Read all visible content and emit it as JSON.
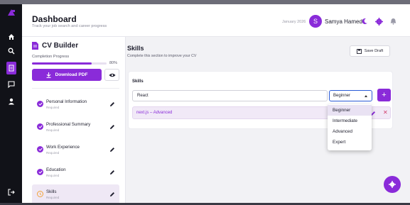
{
  "header": {
    "title": "Dashboard",
    "subtitle": "Track your job search and career progress",
    "date": "January 2026",
    "avatar_initial": "S",
    "user_name": "Samya Hamed"
  },
  "sidebar": {
    "title": "CV Builder",
    "completion_label": "Completion Progress",
    "completion_percent": "80%",
    "completion_fraction": 0.8,
    "download_label": "Download PDF",
    "steps": [
      {
        "label": "Personal Information",
        "status": "Required"
      },
      {
        "label": "Professional Summary",
        "status": "Required"
      },
      {
        "label": "Work Experience",
        "status": "Required"
      },
      {
        "label": "Education",
        "status": "Required"
      },
      {
        "label": "Skills",
        "status": "Required"
      }
    ]
  },
  "main": {
    "title": "Skills",
    "subtitle": "Complete this section to improve your CV",
    "save_label": "Save Draft",
    "card_label": "Skills",
    "skill_input_value": "React",
    "level_value": "Beginner",
    "skills": [
      {
        "name": "next.js",
        "separator": " – ",
        "level": "Advanced"
      }
    ]
  },
  "level_menu": {
    "options": [
      "Beginner",
      "Intermediate",
      "Advanced",
      "Expert"
    ],
    "selected": "Beginner"
  },
  "colors": {
    "accent": "#8a2bd9",
    "rail": "#111218"
  }
}
